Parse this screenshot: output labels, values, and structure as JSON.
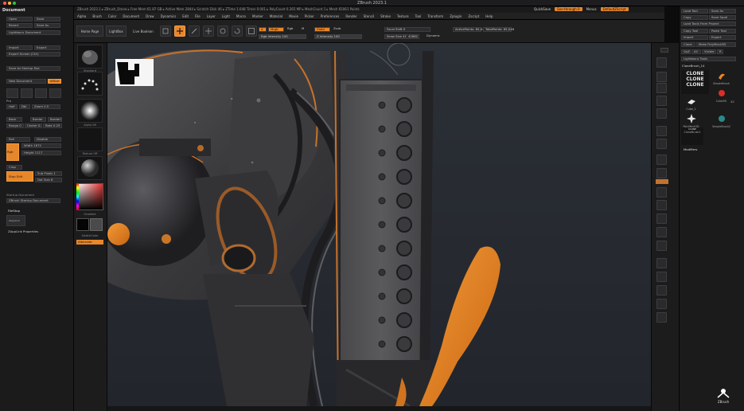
{
  "window": {
    "title": "ZBrush 2023.1"
  },
  "header": {
    "info": "ZBrush 2023.1 ▸ ZBrush_Drone ▸ Free Mem 61.87 GB ▸ Active Mem 2844 ▸ Scratch Disk 46 ▸ ZTime 1.648 Timer 0.001 ▸ PolyCount 0.265 MP ▸ MeshCount 1 ▸ Mesh 65061 Points",
    "quicksave": "QuickSave",
    "seethrough": "See-through 0",
    "menus_label": "Menus",
    "script_label": "DefaultZScript"
  },
  "menubar": {
    "items": [
      "Alpha",
      "Brush",
      "Color",
      "Document",
      "Draw",
      "Dynamics",
      "Edit",
      "File",
      "Layer",
      "Light",
      "Macro",
      "Marker",
      "Material",
      "Movie",
      "Picker",
      "Preferences",
      "Render",
      "Stencil",
      "Stroke",
      "Texture",
      "Tool",
      "Transform",
      "Zplugin",
      "Zscript",
      "Help"
    ]
  },
  "left_panel": {
    "header": "Document",
    "open": "Open",
    "save": "Save",
    "revert": "Revert",
    "save_as": "Save As",
    "lightbox_document": "Lightbox ▸ Document",
    "import": "Import",
    "export": "Export",
    "export_screen": "Export Screen (Ctrl)",
    "save_as_startup": "Save As Startup Doc",
    "new_document": "New Document",
    "wsize": "WSize",
    "pro": "Pro",
    "half": "Half",
    "double": "Dbl",
    "zoom_label": "Zoom 0.5",
    "back": "Back",
    "border": "Border",
    "border2": "Border2",
    "range": "Range 0",
    "center": "Center 0.5",
    "rate": "Rate 0.25",
    "roll": "Roll",
    "disable": "Disable",
    "width": "Width 1672",
    "height": "Height 1117",
    "crop": "Crop",
    "stop_edit": "Stop Edit",
    "subpixels": "Sub Pixels 1",
    "dotsize": "Dot Size 8",
    "startup": "Startup Document",
    "zbrush_startup": "ZBrush Startup Document",
    "filestop": "FileStop",
    "zappl_label": "ZappLink",
    "zapp_props": "ZAppLink Properties"
  },
  "toolbar": {
    "home_page": "Home Page",
    "lightbox": "LightBox",
    "live_boolean": "Live Boolean",
    "edit_label": "Edit",
    "a_label": "A",
    "mrgb": "Mrgb",
    "rgb": "Rgb",
    "m_label": "M",
    "zadd": "Zadd",
    "zsub": "Zsub",
    "zcut": "Zcut",
    "rgb_intensity": "Rgb Intensity 100",
    "z_intensity": "Z Intensity 100",
    "focal_shift": "Focal Shift 0",
    "draw_size": "Draw Size 41",
    "draw_size2": "42882",
    "dynamic": "Dynamic",
    "active_points": "ActivePoints: 65,048",
    "total_points": "TotalPoints: 65,048",
    "rgb_intensity_fill": 1.0,
    "z_intensity_fill": 1.0
  },
  "left_tray": {
    "brush_label": "Standard",
    "alpha_label": "Alpha 06",
    "texture_label": "Texture Off",
    "material_label": "Material",
    "gradient_label": "Gradient",
    "switch_color": "SwitchColor",
    "alternate": "Alternate"
  },
  "right_panel": {
    "load_tool": "Load Tool",
    "save_as": "Save As",
    "copy": "Copy",
    "save_spotlight": "Save Spotl",
    "load_tools_from_project": "Load Tools From Project",
    "copy_tool": "Copy Tool",
    "paste_tool": "Paste Tool",
    "import": "Import",
    "export": "Export",
    "clone": "Clone",
    "make_polymesh": "Make PolyMesh3D",
    "goz": "GoZ",
    "all": "All",
    "visible": "Visible",
    "r": "R",
    "lightbox_tools": "Lightbox ▸ Tools",
    "clonebrush": "CloneBrush_14",
    "clone_text": "CLONE",
    "cell_labels": [
      "CloneBrush",
      "SimpleBrush",
      "Cube3D",
      "Cube_1",
      "PolyMesh3D",
      "SimpleBrush2",
      "CloneBrush2"
    ],
    "number": "42",
    "subtools": "Modifiers"
  },
  "right_tray": {
    "labels": [
      "Bpr",
      "SPix 3",
      "Scroll",
      "Zoom",
      "Actual",
      "AAHalf",
      "Persp",
      "Floor",
      "Local",
      "Frame",
      "Move",
      "Scale",
      "Rotate",
      "Line Fill",
      "PolyF",
      "Transp",
      "Ghost",
      "Solo",
      "Xpose"
    ]
  },
  "colors": {
    "accent": "#e8862a",
    "ui_dark": "#1b1b1c",
    "viewport": "#2b2f36",
    "model_orange": "#e07b1f"
  },
  "watermark": "ZBrush"
}
